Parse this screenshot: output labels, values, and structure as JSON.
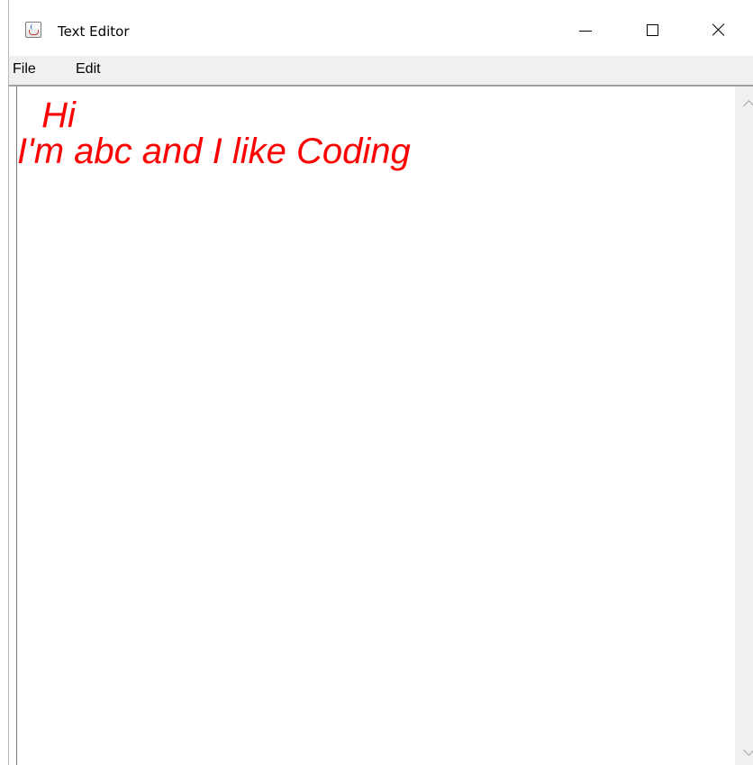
{
  "window": {
    "title": "Text Editor",
    "icon": "java-cup-icon"
  },
  "caption_buttons": {
    "minimize_icon": "minimize-icon",
    "maximize_icon": "maximize-icon",
    "close_icon": "close-icon"
  },
  "menubar": {
    "items": [
      {
        "label": "File"
      },
      {
        "label": "Edit"
      }
    ]
  },
  "editor": {
    "lines": [
      " Hi",
      "I'm abc and I like Coding"
    ],
    "text_color": "#ff0000",
    "font_style": "italic"
  },
  "scrollbar": {
    "up_icon": "chevron-up-icon",
    "down_icon": "chevron-down-icon"
  }
}
